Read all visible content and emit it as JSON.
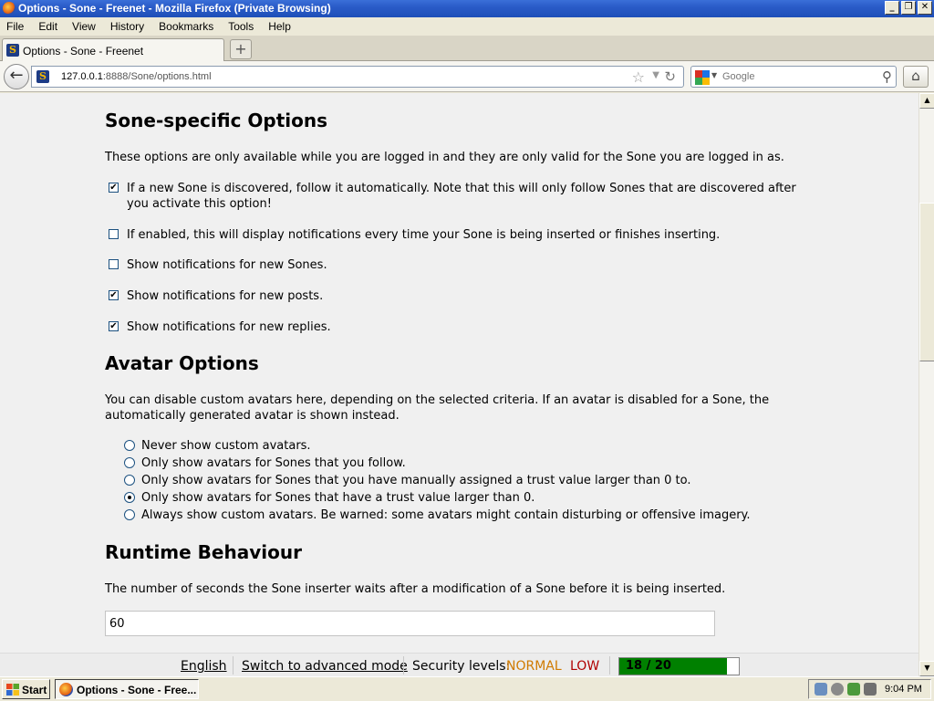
{
  "window": {
    "title": "Options - Sone - Freenet - Mozilla Firefox (Private Browsing)",
    "buttons": [
      "_",
      "❐",
      "✕"
    ]
  },
  "menu": [
    "File",
    "Edit",
    "View",
    "History",
    "Bookmarks",
    "Tools",
    "Help"
  ],
  "tab": {
    "label": "Options - Sone - Freenet",
    "new_tab": "+"
  },
  "navbar": {
    "url_host": "127.0.0.1",
    "url_rest": ":8888/Sone/options.html",
    "search_placeholder": "Google"
  },
  "content": {
    "sone_options": {
      "heading": "Sone-specific Options",
      "description": "These options are only available while you are logged in and they are only valid for the Sone you are logged in as.",
      "options": [
        {
          "label": "If a new Sone is discovered, follow it automatically. Note that this will only follow Sones that are discovered after you activate this option!",
          "checked": true
        },
        {
          "label": "If enabled, this will display notifications every time your Sone is being inserted or finishes inserting.",
          "checked": false
        },
        {
          "label": "Show notifications for new Sones.",
          "checked": false
        },
        {
          "label": "Show notifications for new posts.",
          "checked": true
        },
        {
          "label": "Show notifications for new replies.",
          "checked": true
        }
      ]
    },
    "avatar_options": {
      "heading": "Avatar Options",
      "description": "You can disable custom avatars here, depending on the selected criteria. If an avatar is disabled for a Sone, the automatically generated avatar is shown instead.",
      "choices": [
        {
          "label": "Never show custom avatars.",
          "selected": false
        },
        {
          "label": "Only show avatars for Sones that you follow.",
          "selected": false
        },
        {
          "label": "Only show avatars for Sones that you have manually assigned a trust value larger than 0 to.",
          "selected": false
        },
        {
          "label": "Only show avatars for Sones that have a trust value larger than 0.",
          "selected": true
        },
        {
          "label": "Always show custom avatars. Be warned: some avatars might contain disturbing or offensive imagery.",
          "selected": false
        }
      ]
    },
    "runtime": {
      "heading": "Runtime Behaviour",
      "description": "The number of seconds the Sone inserter waits after a modification of a Sone before it is being inserted.",
      "insertion_delay": "60"
    }
  },
  "footer": {
    "language": "English",
    "advanced_mode": "Switch to advanced mode",
    "security_label": "Security levels:",
    "security_network": "NORMAL",
    "security_physical": "LOW",
    "peers_text": "18 / 20",
    "peers_fraction": 0.9,
    "peers_color": "#008000"
  },
  "taskbar": {
    "start": "Start",
    "task": "Options - Sone - Free...",
    "clock": "9:04 PM"
  }
}
